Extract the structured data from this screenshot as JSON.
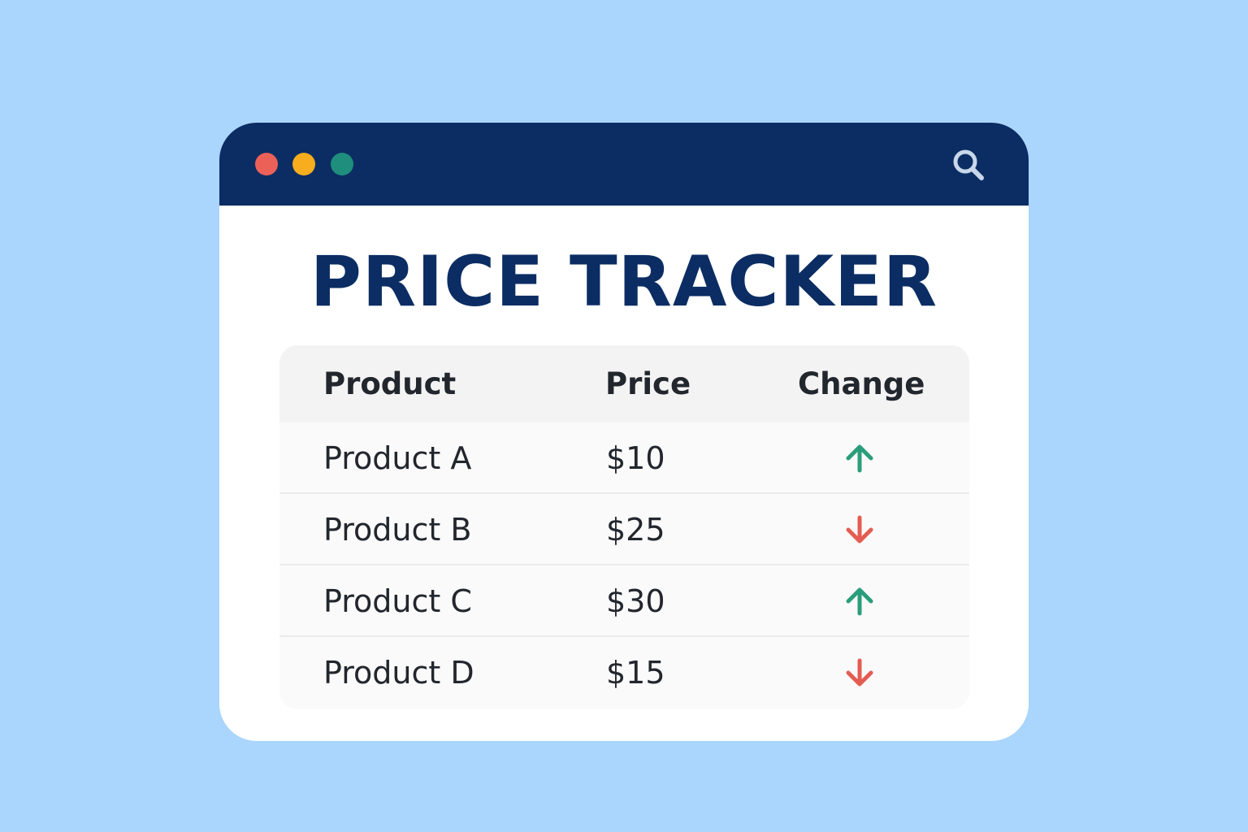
{
  "window": {
    "title": "PRICE TRACKER",
    "search_icon": "search-icon"
  },
  "colors": {
    "background": "#aad5fd",
    "titlebar": "#0b2d63",
    "title_text": "#0b2d63",
    "dot_red": "#ec6157",
    "dot_yellow": "#f8ad1e",
    "dot_green": "#1f8e7c",
    "up": "#2a9d7a",
    "down": "#e45d52",
    "search_icon": "#c9d7ea"
  },
  "table": {
    "headers": {
      "product": "Product",
      "price": "Price",
      "change": "Change"
    },
    "rows": [
      {
        "product": "Product A",
        "price": "$10",
        "change": "up"
      },
      {
        "product": "Product B",
        "price": "$25",
        "change": "down"
      },
      {
        "product": "Product C",
        "price": "$30",
        "change": "up"
      },
      {
        "product": "Product D",
        "price": "$15",
        "change": "down"
      }
    ]
  }
}
